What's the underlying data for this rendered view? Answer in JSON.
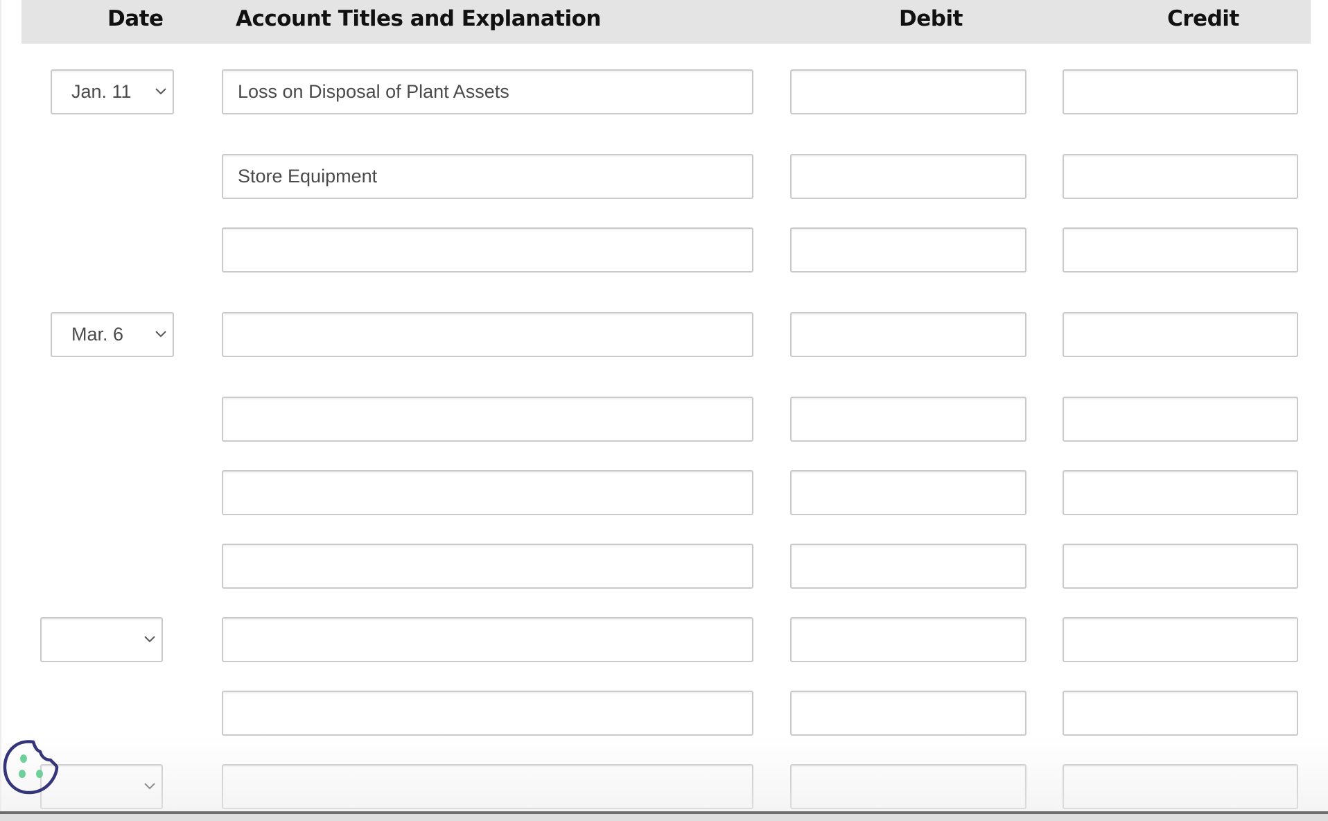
{
  "header": {
    "date": "Date",
    "account": "Account Titles and Explanation",
    "debit": "Debit",
    "credit": "Credit"
  },
  "rows": [
    {
      "date": "Jan. 11",
      "account": "Loss on Disposal of Plant Assets",
      "debit": "",
      "credit": ""
    },
    {
      "date": null,
      "account": "Store Equipment",
      "debit": "",
      "credit": ""
    },
    {
      "date": null,
      "account": "",
      "debit": "",
      "credit": ""
    },
    {
      "date": "Mar. 6",
      "account": "",
      "debit": "",
      "credit": ""
    },
    {
      "date": null,
      "account": "",
      "debit": "",
      "credit": ""
    },
    {
      "date": null,
      "account": "",
      "debit": "",
      "credit": ""
    },
    {
      "date": null,
      "account": "",
      "debit": "",
      "credit": ""
    },
    {
      "date": "",
      "account": "",
      "debit": "",
      "credit": ""
    },
    {
      "date": null,
      "account": "",
      "debit": "",
      "credit": ""
    },
    {
      "date": "",
      "account": "",
      "debit": "",
      "credit": ""
    }
  ],
  "icons": {
    "dropdown": "chevron-down-icon",
    "cookie": "cookie-icon"
  },
  "colors": {
    "header_bg": "#e4e4e4",
    "border": "#cacaca",
    "cookie_outline": "#35357a",
    "cookie_dots": "#6fcf9a"
  }
}
